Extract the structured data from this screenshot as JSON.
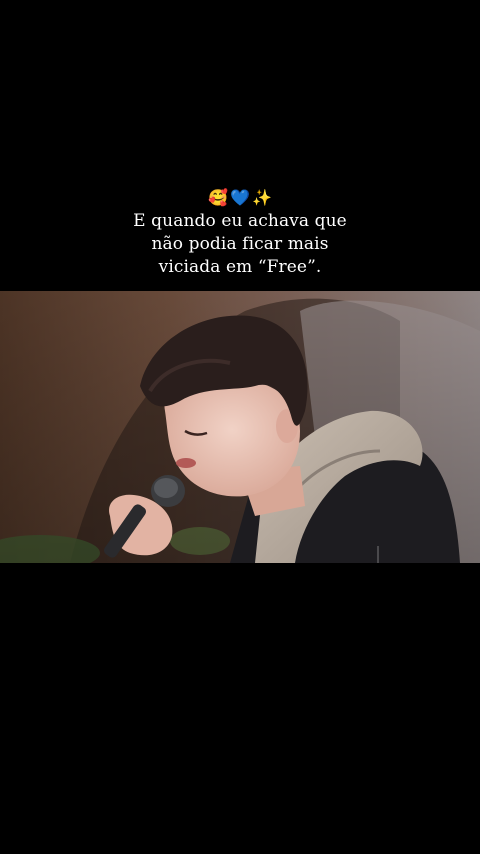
{
  "caption": {
    "emojis": [
      "🥰",
      "💙",
      "✨"
    ],
    "lines": [
      "E quando eu achava que",
      "não podia ficar mais",
      "viciada em “Free”."
    ]
  },
  "colors": {
    "background": "#000000",
    "caption_text": "#ffffff"
  },
  "video": {
    "description_icon": "video-frame"
  }
}
